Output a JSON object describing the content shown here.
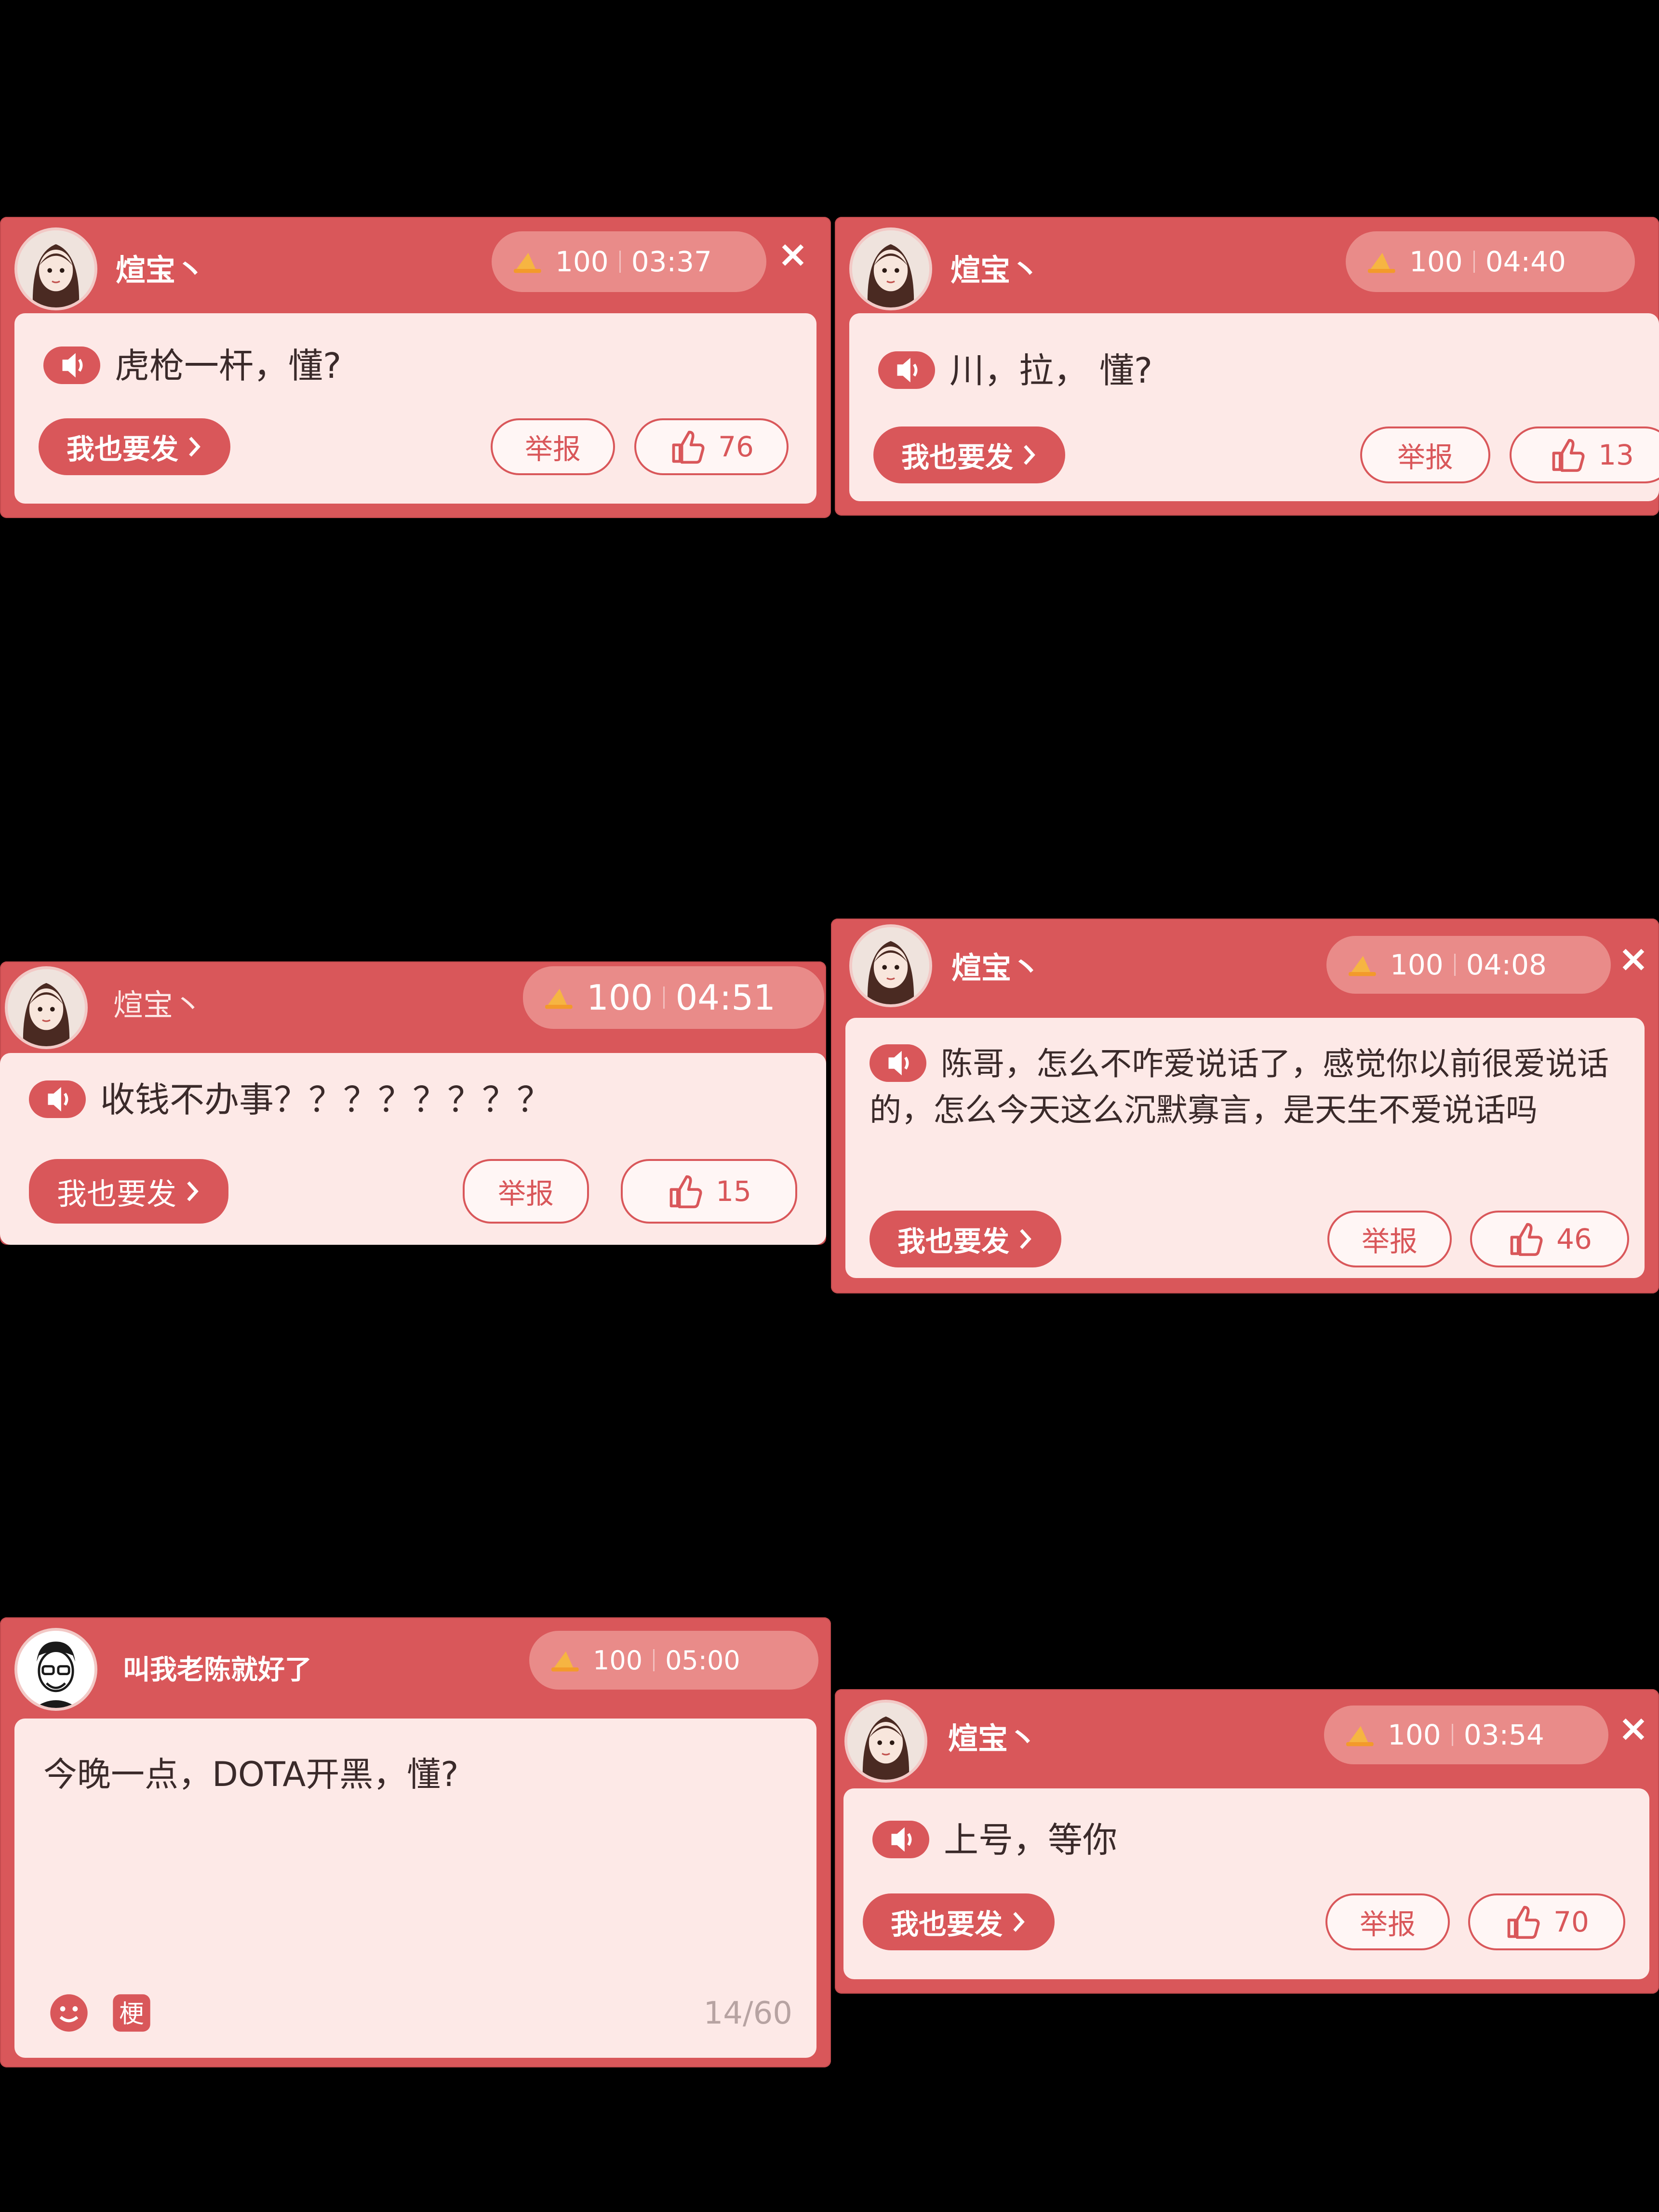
{
  "colors": {
    "accent": "#d9575a",
    "body": "#fde9e7",
    "background": "#000000"
  },
  "icons": {
    "coin": "coin-icon",
    "close": "close-icon",
    "speaker": "speaker-icon",
    "chevron": "chevron-right-icon",
    "like": "thumbs-up-icon",
    "emoji": "emoji-icon",
    "meme": "meme-icon"
  },
  "cards": [
    {
      "username": "煊宝丶",
      "coins": "100",
      "time": "03:37",
      "message": "虎枪一杆，懂?",
      "send_label": "我也要发",
      "report_label": "举报",
      "likes": "76"
    },
    {
      "username": "煊宝丶",
      "coins": "100",
      "time": "04:40",
      "message": "川，拉， 懂?",
      "send_label": "我也要发",
      "report_label": "举报",
      "likes": "13"
    },
    {
      "username": "煊宝丶",
      "coins": "100",
      "time": "04:51",
      "message": "收钱不办事？？？？？？？？",
      "send_label": "我也要发",
      "report_label": "举报",
      "likes": "15"
    },
    {
      "username": "煊宝丶",
      "coins": "100",
      "time": "04:08",
      "message": "陈哥，怎么不咋爱说话了，感觉你以前很爱说话的，怎么今天这么沉默寡言，是天生不爱说话吗",
      "send_label": "我也要发",
      "report_label": "举报",
      "likes": "46"
    },
    {
      "username": "叫我老陈就好了",
      "coins": "100",
      "time": "05:00",
      "message": "今晚一点，DOTA开黑，懂?",
      "counter": "14/60",
      "meme_label": "梗"
    },
    {
      "username": "煊宝丶",
      "coins": "100",
      "time": "03:54",
      "message": "上号，等你",
      "send_label": "我也要发",
      "report_label": "举报",
      "likes": "70"
    }
  ]
}
